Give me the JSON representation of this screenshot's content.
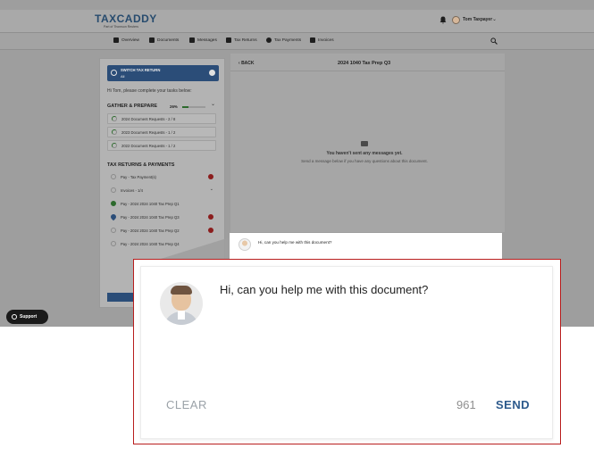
{
  "app": {
    "logo": "TAXCADDY",
    "logo_sub": "Part of Thomson Reuters",
    "user_name": "Tom Taxpayer"
  },
  "nav": [
    {
      "label": "Overview",
      "icon": "home-icon"
    },
    {
      "label": "Documents",
      "icon": "documents-icon"
    },
    {
      "label": "Messages",
      "icon": "messages-icon"
    },
    {
      "label": "Tax Returns",
      "icon": "tax-returns-icon"
    },
    {
      "label": "Tax Payments",
      "icon": "dollar-icon"
    },
    {
      "label": "Invoices",
      "icon": "invoice-icon"
    }
  ],
  "panel": {
    "switch_title": "SWITCH TAX RETURN",
    "switch_sub": "All",
    "greeting": "Hi Tom, please complete your tasks below:",
    "gather_title": "GATHER & PREPARE",
    "gather_percent": "26%",
    "gather_progress": 0.26,
    "gather_items": [
      "2024 Document Requests - 2 / 8",
      "2023 Document Requests - 1 / 2",
      "2022 Document Requests - 1 / 2"
    ],
    "returns_title": "TAX RETURNS & PAYMENTS",
    "pay_item": "Pay - Tax Payment(s)",
    "invoices_item": "Invoices - 1/4",
    "invoice_rows": [
      "Pay - 2024 2024 1040 Tax Prep Q1",
      "Pay - 2024 2024 1040 Tax Prep Q3",
      "Pay - 2024 2024 1040 Tax Prep Q2",
      "Pay - 2024 2024 1040 Tax Prep Q4"
    ]
  },
  "messages": {
    "back": "BACK",
    "title": "2024 1040 Tax Prep Q3",
    "empty_title": "You haven't sent any messages yet.",
    "empty_sub": "Send a message below if you have any questions about this document."
  },
  "support": "Support",
  "composer": {
    "message": "Hi, can you help me with this document?",
    "clear": "CLEAR",
    "count": "961",
    "send": "SEND"
  },
  "colors": {
    "brand": "#2b4d78",
    "send": "#2d5a8c",
    "highlight_border": "#b81d1d"
  }
}
